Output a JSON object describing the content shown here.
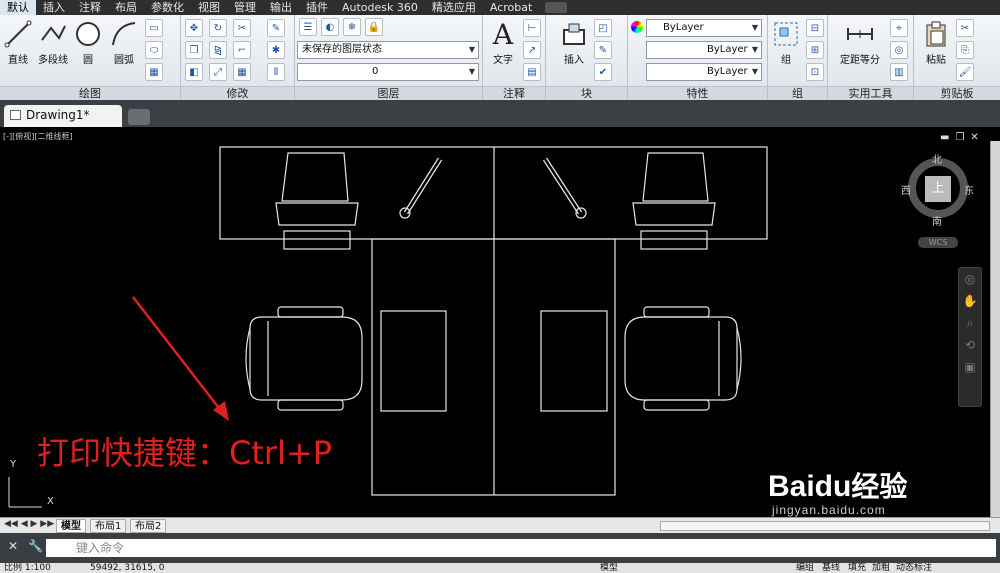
{
  "menu": {
    "tabs": [
      "默认",
      "插入",
      "注释",
      "布局",
      "参数化",
      "视图",
      "管理",
      "输出",
      "插件",
      "Autodesk 360",
      "精选应用",
      "Acrobat"
    ],
    "active_index": 0
  },
  "ribbon": {
    "draw": {
      "title": "绘图",
      "line": "直线",
      "polyline": "多段线",
      "circle": "圆",
      "arc": "圆弧"
    },
    "modify": {
      "title": "修改"
    },
    "layers": {
      "title": "图层",
      "state": "未保存的图层状态",
      "current_layer": "0"
    },
    "annotation": {
      "title": "注释",
      "text": "文字"
    },
    "block": {
      "title": "块",
      "insert": "插入"
    },
    "properties": {
      "title": "特性",
      "color": "ByLayer",
      "linetype": "ByLayer",
      "lineweight": "ByLayer"
    },
    "groups": {
      "title": "组",
      "group": "组"
    },
    "utilities": {
      "title": "实用工具",
      "measure": "定距等分"
    },
    "clipboard": {
      "title": "剪贴板",
      "paste": "粘贴"
    }
  },
  "document": {
    "tab": "Drawing1*"
  },
  "viewport": {
    "label": "[-][俯视][二维线框]",
    "annotation": "打印快捷键：Ctrl+P",
    "annotation_color": "#e02020"
  },
  "viewcube": {
    "north": "北",
    "south": "南",
    "east": "东",
    "west": "西",
    "top": "上",
    "wcs": "WCS"
  },
  "ucs": {
    "x": "X",
    "y": "Y"
  },
  "layouts": {
    "tabs": [
      "模型",
      "布局1",
      "布局2"
    ]
  },
  "command": {
    "placeholder": "键入命令"
  },
  "status": {
    "scale": "比例 1:100",
    "coords": "59492, 31615, 0",
    "model": "模型",
    "a": "编组",
    "b": "基线",
    "c": "填充",
    "d": "加粗",
    "e": "动态标注"
  },
  "watermark": {
    "brand": "Baidu",
    "cn": "经验",
    "url": "jingyan.baidu.com"
  }
}
